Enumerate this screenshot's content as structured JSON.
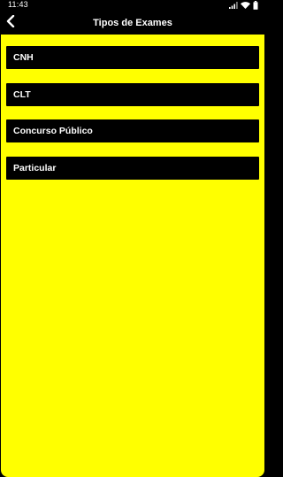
{
  "status_bar": {
    "time": "11:43",
    "icons": [
      "signal-icon",
      "wifi-icon",
      "battery-icon"
    ]
  },
  "app_bar": {
    "title": "Tipos de Exames",
    "back_icon": "back-arrow-icon"
  },
  "exam_types": [
    {
      "label": "CNH"
    },
    {
      "label": "CLT"
    },
    {
      "label": "Concurso Público"
    },
    {
      "label": "Particular"
    }
  ],
  "colors": {
    "background": "#ffff00",
    "item_background": "#000000",
    "item_text": "#ffffff",
    "app_bar": "#000000"
  }
}
